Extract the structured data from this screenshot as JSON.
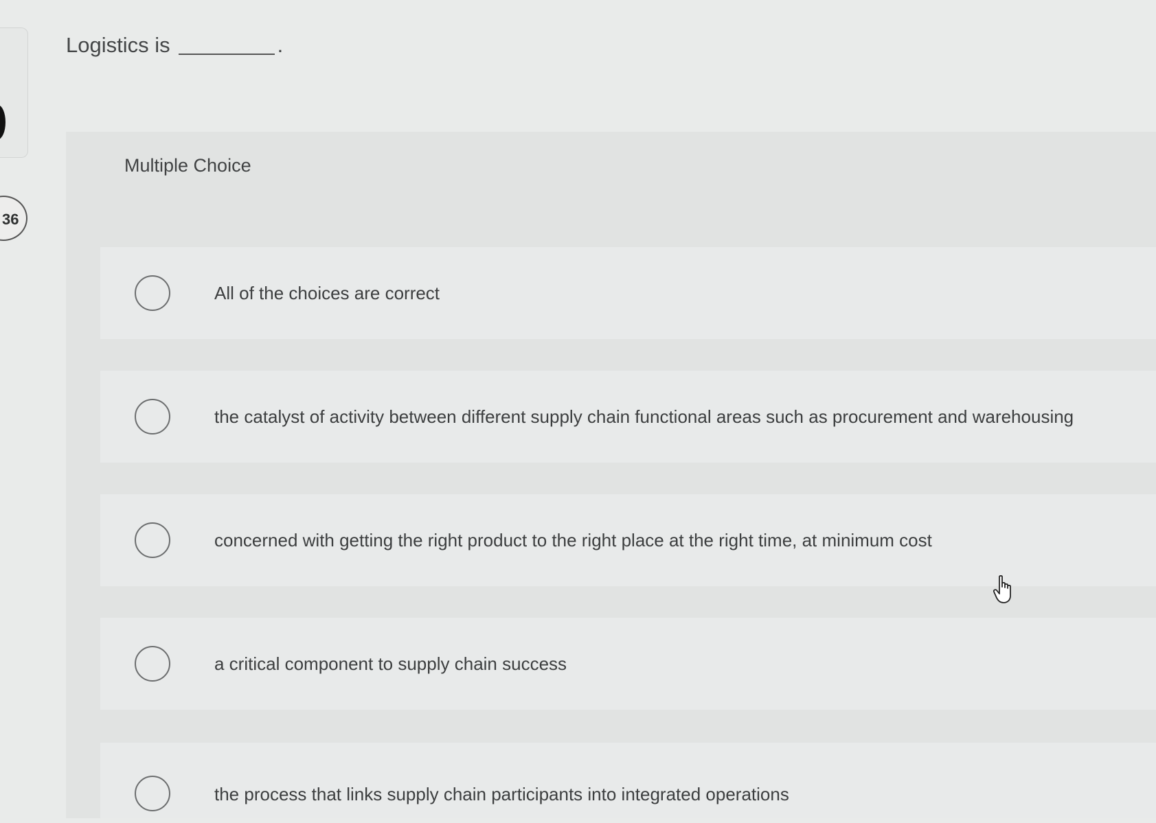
{
  "question": {
    "number": "36",
    "stem_prefix": "Logistics is",
    "stem_suffix": "."
  },
  "multiple_choice": {
    "label": "Multiple Choice",
    "options": [
      {
        "label": "All of the choices are correct",
        "selected": false
      },
      {
        "label": "the catalyst of activity between different supply chain functional areas such as procurement and warehousing",
        "selected": false
      },
      {
        "label": "concerned with getting the right product to the right place at the right time, at minimum cost",
        "selected": false
      },
      {
        "label": "a critical component to supply chain success",
        "selected": false
      },
      {
        "label": "the process that links supply chain participants into integrated operations",
        "selected": false
      }
    ]
  },
  "cursor": {
    "icon": "hand-pointer-icon"
  }
}
